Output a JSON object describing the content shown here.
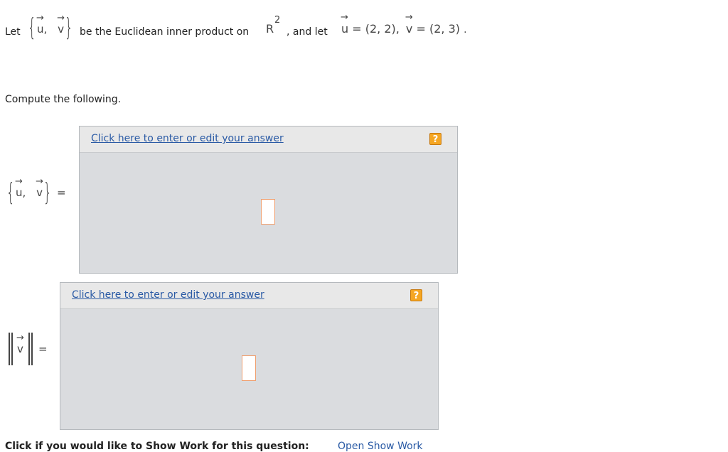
{
  "problem": {
    "let_text": "Let",
    "inner_product_desc": "be the Euclidean inner product on",
    "space": "R",
    "space_exponent": "2",
    "and_let_text": ", and let",
    "u_name": "u",
    "v_name": "v",
    "u_value": "= (2, 2),",
    "v_value": "= (2, 3)",
    "period": ".",
    "comma": ","
  },
  "instruction": "Compute the following.",
  "questions": [
    {
      "lhs_equals": "=",
      "answer_link": "Click here to enter or edit your answer",
      "help_label": "?"
    },
    {
      "lhs_equals": "=",
      "answer_link": "Click here to enter or edit your answer",
      "help_label": "?"
    }
  ],
  "show_work": {
    "prompt": "Click if you would like to Show Work for this question:",
    "link": "Open Show Work"
  },
  "colors": {
    "link": "#2a5aa5",
    "help_button": "#f5a623",
    "answer_panel": "#dadcdf",
    "input_border": "#f0a070"
  }
}
